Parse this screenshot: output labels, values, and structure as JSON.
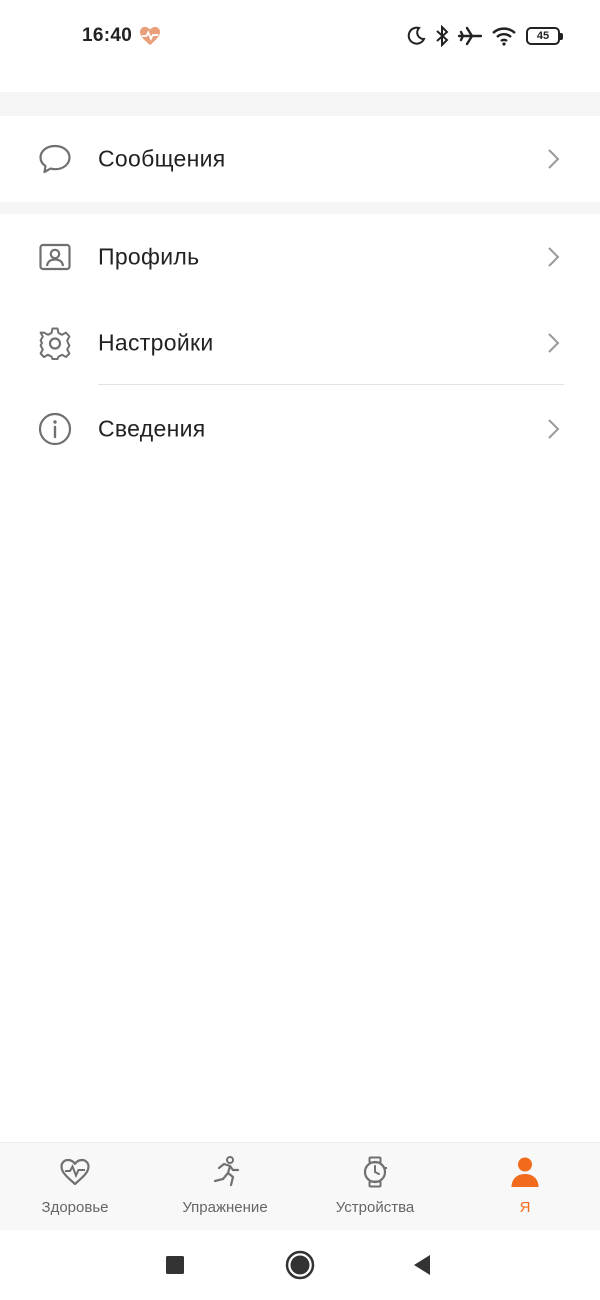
{
  "status_bar": {
    "time": "16:40",
    "battery_level": "45",
    "icons": [
      "heart-rate-icon",
      "moon-icon",
      "bluetooth-icon",
      "airplane-icon",
      "wifi-icon",
      "battery-icon"
    ]
  },
  "menu": {
    "items": [
      {
        "label": "Сообщения",
        "icon": "chat-bubble-icon"
      },
      {
        "label": "Профиль",
        "icon": "profile-card-icon"
      },
      {
        "label": "Настройки",
        "icon": "gear-icon"
      },
      {
        "label": "Сведения",
        "icon": "info-icon"
      }
    ]
  },
  "tabbar": {
    "tabs": [
      {
        "label": "Здоровье",
        "icon": "heart-pulse-icon"
      },
      {
        "label": "Упражнение",
        "icon": "running-icon"
      },
      {
        "label": "Устройства",
        "icon": "watch-icon"
      },
      {
        "label": "Я",
        "icon": "person-icon",
        "active": true
      }
    ]
  },
  "colors": {
    "accent": "#f26b1d",
    "icon_gray": "#707070",
    "separator": "#f5f5f5"
  }
}
